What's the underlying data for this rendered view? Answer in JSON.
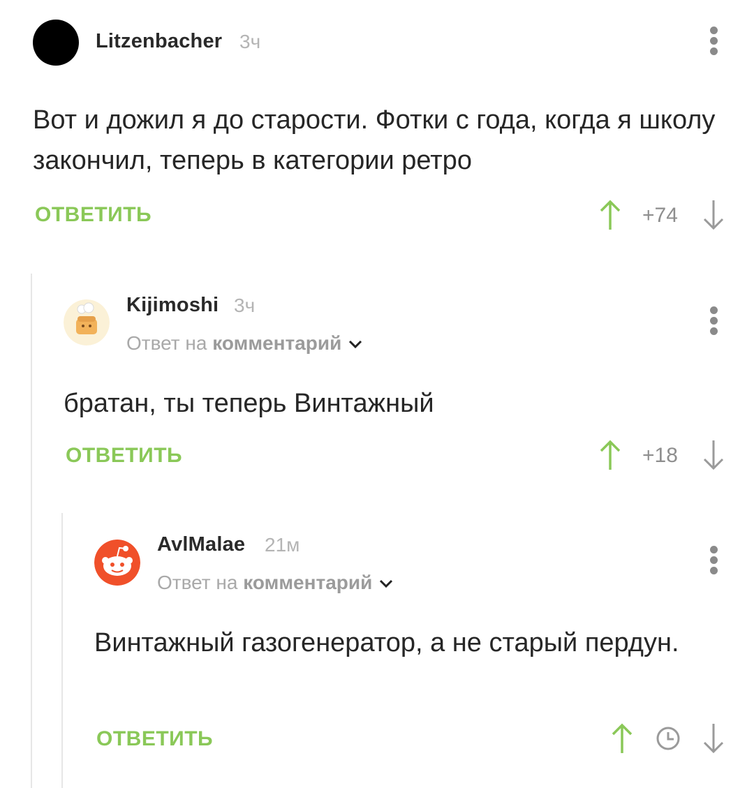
{
  "comments": [
    {
      "author": "Litzenbacher",
      "time": "3ч",
      "text": "Вот и дожил я до старости. Фотки с года, когда я школу закончил, теперь в категории ретро",
      "reply_label": "ОТВЕТИТЬ",
      "rating": "+74"
    },
    {
      "author": "Kijimoshi",
      "time": "3ч",
      "reply_prefix": "Ответ на",
      "reply_target": "комментарий",
      "text": "братан, ты теперь Винтажный",
      "reply_label": "ОТВЕТИТЬ",
      "rating": "+18"
    },
    {
      "author": "AvlMalae",
      "time": "21м",
      "reply_prefix": "Ответ на",
      "reply_target": "комментарий",
      "text": "Винтажный газогенератор, а не старый пердун.",
      "reply_label": "ОТВЕТИТЬ"
    }
  ],
  "icons": {
    "upvote": "arrow-up-icon",
    "downvote": "arrow-down-icon",
    "menu": "more-vertical-icon",
    "pending": "clock-icon",
    "expand": "chevron-down-icon"
  },
  "colors": {
    "accent_green": "#8ac858",
    "muted_text": "#a9a9a9",
    "reddit_orange": "#f0502a"
  }
}
